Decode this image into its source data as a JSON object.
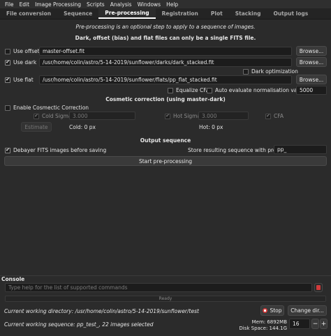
{
  "menu": [
    "File",
    "Edit",
    "Image Processing",
    "Scripts",
    "Analysis",
    "Windows",
    "Help"
  ],
  "tabs": [
    {
      "label": "File conversion",
      "active": false
    },
    {
      "label": "Sequence",
      "active": false
    },
    {
      "label": "Pre-processing",
      "active": true
    },
    {
      "label": "Registration",
      "active": false
    },
    {
      "label": "Plot",
      "active": false
    },
    {
      "label": "Stacking",
      "active": false
    },
    {
      "label": "Output logs",
      "active": false
    }
  ],
  "intro": "Pre-processing is an optional step to apply to a sequence of images.",
  "heading": "Dark, offset (bias) and flat files can only be a single FITS file.",
  "offset": {
    "label": "Use offset",
    "checked": false,
    "path": "master-offset.fit",
    "browse": "Browse..."
  },
  "dark": {
    "label": "Use dark",
    "checked": true,
    "path": "/usr/home/colin/astro/5-14-2019/sunflower/darks/dark_stacked.fit",
    "browse": "Browse...",
    "optimization_label": "Dark optimization",
    "optimization_checked": false
  },
  "flat": {
    "label": "Use flat",
    "checked": true,
    "path": "/usr/home/colin/astro/5-14-2019/sunflower/flats/pp_flat_stacked.fit",
    "browse": "Browse...",
    "equalize_cfa": "Equalize CFA",
    "auto_norm": "Auto evaluate normalisation value",
    "norm_value": "5000"
  },
  "cosmetic": {
    "title": "Cosmetic correction (using master-dark)",
    "enable_label": "Enable Cosmectic Correction",
    "cold_sigma_label": "Cold Sigma:",
    "cold_sigma_value": "3.000",
    "hot_sigma_label": "Hot Sigma:",
    "hot_sigma_value": "3.000",
    "cfa_label": "CFA",
    "estimate": "Estimate",
    "cold_px": "Cold: 0 px",
    "hot_px": "Hot: 0 px"
  },
  "output": {
    "title": "Output sequence",
    "debayer_label": "Debayer FITS images before saving",
    "prefix_label": "Store resulting sequence with prefix:",
    "prefix_value": "pp_",
    "start": "Start pre-processing"
  },
  "console": {
    "title": "Console",
    "placeholder": "Type help for the list of supported commands",
    "status": "Ready"
  },
  "footer": {
    "cwd": "Current working directory: /usr/home/colin/astro/5-14-2019/sunflower/test",
    "cws": "Current working sequence: pp_test_, 22 images selected",
    "stop": "Stop",
    "change_dir": "Change dir...",
    "mem": "Mem: 6892MB",
    "disk": "Disk Space: 144.1G",
    "threads": "16"
  }
}
